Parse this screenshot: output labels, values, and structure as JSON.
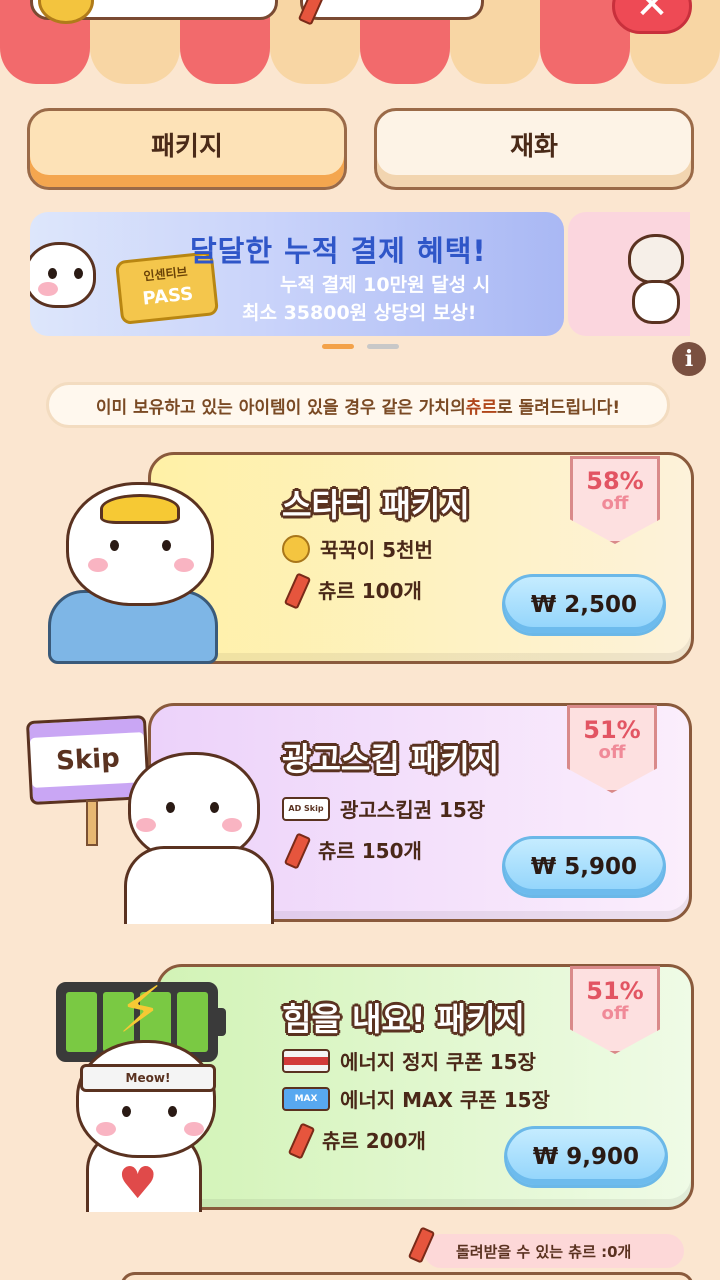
{
  "top_bar": {
    "coin_value": "",
    "churu_value": "",
    "close_symbol": "✕"
  },
  "tabs": [
    {
      "label": "패키지",
      "selected": true
    },
    {
      "label": "재화",
      "selected": false
    }
  ],
  "banner": {
    "title": "달달한 누적 결제 혜택!",
    "line1": "누적 결제 10만원 달성 시",
    "line2": "최소 35800원 상당의 보상!",
    "ticket_top": "인센티브",
    "ticket_word": "PASS",
    "page_index": 1,
    "page_count": 2
  },
  "info_symbol": "i",
  "notice": {
    "before": "이미 보유하고 있는 아이템이 있을 경우 같은 가치의 ",
    "highlight": "츄르",
    "after": "로 돌려드립니다!"
  },
  "packages": [
    {
      "title": "스타터 패키지",
      "discount_pct": "58%",
      "discount_off": "off",
      "items": [
        {
          "icon": "coin-icon",
          "label": "꾹꾹이 5천번"
        },
        {
          "icon": "churu-icon",
          "label": "츄르 100개"
        }
      ],
      "price": "₩ 2,500",
      "colors": {
        "card": "#fff1a6"
      }
    },
    {
      "title": "광고스킵 패키지",
      "discount_pct": "51%",
      "discount_off": "off",
      "sign_text": "Skip",
      "items": [
        {
          "icon": "ad-skip-ticket-icon",
          "label": "광고스킵권 15장",
          "icon_text": "AD Skip"
        },
        {
          "icon": "churu-icon",
          "label": "츄르 150개"
        }
      ],
      "price": "₩ 5,900",
      "colors": {
        "card": "#ecd2fa"
      }
    },
    {
      "title": "힘을 내요! 패키지",
      "discount_pct": "51%",
      "discount_off": "off",
      "headband_text": "Meow!",
      "items": [
        {
          "icon": "energy-stop-coupon-icon",
          "label": "에너지 정지 쿠폰 15장"
        },
        {
          "icon": "energy-max-coupon-icon",
          "label": "에너지 MAX 쿠폰 15장",
          "icon_text": "MAX"
        },
        {
          "icon": "churu-icon",
          "label": "츄르 200개"
        }
      ],
      "price": "₩ 9,900",
      "colors": {
        "card": "#d2f3b6"
      }
    }
  ],
  "refund": {
    "label": "돌려받을 수 있는 츄르 : ",
    "count": "0개"
  },
  "colors": {
    "background": "#fbe6d0",
    "awning_red": "#f26a6c",
    "awning_cream": "#f8d6a4",
    "price_button": "#8fd3fb",
    "sale_text": "#e25563"
  }
}
